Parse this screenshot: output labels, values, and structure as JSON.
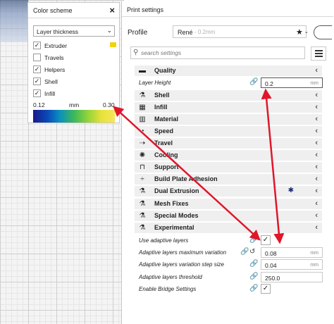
{
  "color_scheme": {
    "title": "Color scheme",
    "close_icon": "×",
    "dropdown_value": "Layer thickness",
    "dropdown_chevron": "⌄",
    "items": [
      {
        "label": "Extruder",
        "checked": true,
        "swatch_color": "#f4d10a"
      },
      {
        "label": "Travels",
        "checked": false
      },
      {
        "label": "Helpers",
        "checked": true
      },
      {
        "label": "Shell",
        "checked": true
      },
      {
        "label": "Infill",
        "checked": true
      }
    ],
    "scale_min": "0.12",
    "scale_unit": "mm",
    "scale_max": "0.30",
    "check_glyph": "✓"
  },
  "print_settings": {
    "title": "Print settings",
    "profile_label": "Profile",
    "profile_name": "René",
    "profile_sub": "- 0.2mm",
    "star_icon": "★",
    "star_chevron": "⌄",
    "search_placeholder": "search settings",
    "search_icon": "⚲",
    "chevron_glyph": "‹",
    "link_glyph": "🔗",
    "reset_glyph": "↺",
    "gear_glyph": "✱",
    "categories": [
      {
        "label": "Quality",
        "icon": "▬"
      },
      {
        "label": "Shell",
        "icon": "⚗"
      },
      {
        "label": "Infill",
        "icon": "▦"
      },
      {
        "label": "Material",
        "icon": "▥"
      },
      {
        "label": "Speed",
        "icon": "◔"
      },
      {
        "label": "Travel",
        "icon": "⇢"
      },
      {
        "label": "Cooling",
        "icon": "✺"
      },
      {
        "label": "Support",
        "icon": "⊓"
      },
      {
        "label": "Build Plate Adhesion",
        "icon": "÷"
      },
      {
        "label": "Dual Extrusion",
        "icon": "⚗"
      },
      {
        "label": "Mesh Fixes",
        "icon": "⚗"
      },
      {
        "label": "Special Modes",
        "icon": "⚗"
      },
      {
        "label": "Experimental",
        "icon": "⚗"
      }
    ],
    "layer_height": {
      "label": "Layer Height",
      "value": "0.2",
      "unit": "mm"
    },
    "use_adaptive_layers": {
      "label": "Use adaptive layers",
      "checked": true
    },
    "adaptive_max_variation": {
      "label": "Adaptive layers maximum variation",
      "value": "0.08",
      "unit": "mm"
    },
    "adaptive_step_size": {
      "label": "Adaptive layers variation step size",
      "value": "0.04",
      "unit": "mm"
    },
    "adaptive_threshold": {
      "label": "Adaptive layers threshold",
      "value": "250.0",
      "unit": ""
    },
    "enable_bridge": {
      "label": "Enable Bridge Settings",
      "checked": true
    }
  },
  "colors": {
    "arrow": "#e0162b",
    "accent": "#1c2c6e",
    "category_bg": "#efefef"
  }
}
